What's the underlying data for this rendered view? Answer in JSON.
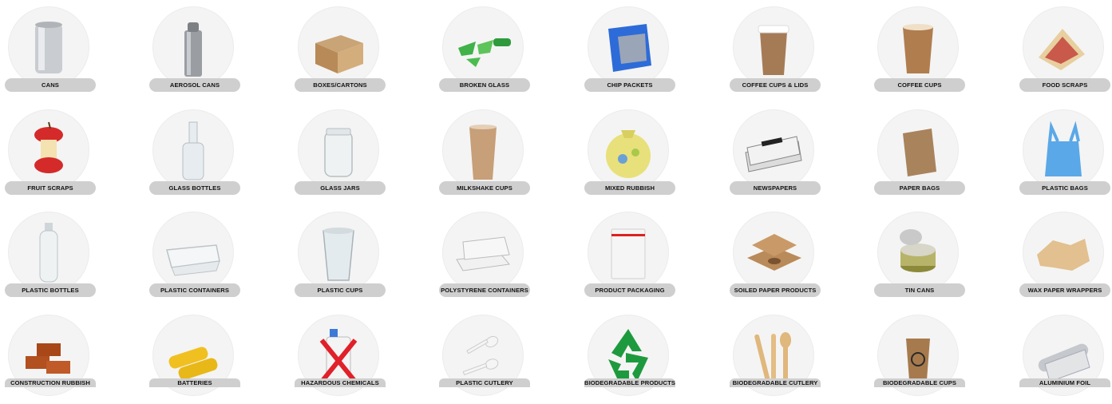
{
  "items": [
    {
      "label": "CANS",
      "icon": "aluminium-can-icon"
    },
    {
      "label": "AEROSOL CANS",
      "icon": "aerosol-can-icon"
    },
    {
      "label": "BOXES/CARTONS",
      "icon": "cardboard-box-icon"
    },
    {
      "label": "BROKEN GLASS",
      "icon": "broken-glass-icon"
    },
    {
      "label": "CHIP PACKETS",
      "icon": "chip-packet-icon"
    },
    {
      "label": "COFFEE CUPS & LIDS",
      "icon": "coffee-cup-lid-icon"
    },
    {
      "label": "COFFEE CUPS",
      "icon": "coffee-cup-icon"
    },
    {
      "label": "FOOD SCRAPS",
      "icon": "sandwich-icon"
    },
    {
      "label": "FRUIT SCRAPS",
      "icon": "apple-core-icon"
    },
    {
      "label": "GLASS BOTTLES",
      "icon": "glass-bottle-icon"
    },
    {
      "label": "GLASS JARS",
      "icon": "glass-jar-icon"
    },
    {
      "label": "MILKSHAKE CUPS",
      "icon": "milkshake-cup-icon"
    },
    {
      "label": "MIXED RUBBISH",
      "icon": "rubbish-bag-icon"
    },
    {
      "label": "NEWSPAPERS",
      "icon": "newspaper-icon"
    },
    {
      "label": "PAPER BAGS",
      "icon": "paper-bag-icon"
    },
    {
      "label": "PLASTIC BAGS",
      "icon": "plastic-bag-icon"
    },
    {
      "label": "PLASTIC BOTTLES",
      "icon": "plastic-bottle-icon"
    },
    {
      "label": "PLASTIC CONTAINERS",
      "icon": "plastic-container-icon"
    },
    {
      "label": "PLASTIC CUPS",
      "icon": "plastic-cup-icon"
    },
    {
      "label": "POLYSTYRENE CONTAINERS",
      "icon": "polystyrene-container-icon"
    },
    {
      "label": "PRODUCT PACKAGING",
      "icon": "packaging-bag-icon"
    },
    {
      "label": "SOILED PAPER PRODUCTS",
      "icon": "pizza-box-icon"
    },
    {
      "label": "TIN CANS",
      "icon": "tin-can-icon"
    },
    {
      "label": "WAX PAPER WRAPPERS",
      "icon": "wax-paper-icon"
    },
    {
      "label": "CONSTRUCTION RUBBISH",
      "icon": "bricks-icon"
    },
    {
      "label": "BATTERIES",
      "icon": "battery-icon"
    },
    {
      "label": "HAZARDOUS CHEMICALS",
      "icon": "hazardous-chemical-icon"
    },
    {
      "label": "PLASTIC CUTLERY",
      "icon": "plastic-cutlery-icon"
    },
    {
      "label": "BIODEGRADABLE PRODUCTS",
      "icon": "recycle-symbol-icon"
    },
    {
      "label": "BIODEGRADABLE CUTLERY",
      "icon": "wooden-cutlery-icon"
    },
    {
      "label": "BIODEGRADABLE CUPS",
      "icon": "biodegradable-cup-icon"
    },
    {
      "label": "ALUMINIUM FOIL",
      "icon": "foil-roll-icon"
    }
  ]
}
